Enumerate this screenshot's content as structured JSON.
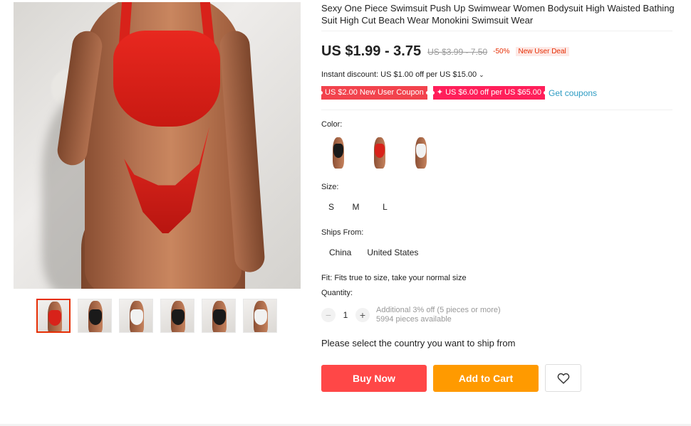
{
  "product": {
    "title": "Sexy One Piece Swimsuit Push Up Swimwear Women Bodysuit High Waisted Bathing Suit High Cut Beach Wear Monokini Swimsuit Wear",
    "price": "US $1.99 - 3.75",
    "original_price": "US $3.99 - 7.50",
    "discount": "-50%",
    "deal_badge": "New User Deal"
  },
  "discounts": {
    "instant": "Instant discount: US $1.00 off per US $15.00",
    "coupon_1": "US $2.00 New User Coupon",
    "coupon_2": "✦ US $6.00 off per US $65.00",
    "get_coupons": "Get coupons"
  },
  "options": {
    "color_label": "Color:",
    "colors": [
      {
        "name": "black",
        "suit_color": "#1a1a1a"
      },
      {
        "name": "red",
        "suit_color": "#d8221a"
      },
      {
        "name": "white",
        "suit_color": "#f1f1f1"
      }
    ],
    "size_label": "Size:",
    "sizes": [
      "S",
      "M",
      "L"
    ],
    "ships_label": "Ships From:",
    "ships_from": [
      "China",
      "United States"
    ],
    "fit": "Fit: Fits true to size, take your normal size"
  },
  "quantity": {
    "label": "Quantity:",
    "minus": "−",
    "value": "1",
    "plus": "+",
    "additional": "Additional 3% off (5 pieces or more)",
    "available": "5994 pieces available"
  },
  "ship_message": "Please select the country you want to ship from",
  "actions": {
    "buy_now": "Buy Now",
    "add_to_cart": "Add to Cart",
    "wishlist_icon": "heart-outline-icon"
  },
  "gallery": {
    "thumbnails": [
      {
        "suit_color": "#d8221a",
        "active": true
      },
      {
        "suit_color": "#1a1a1a",
        "active": false
      },
      {
        "suit_color": "#f1f1f1",
        "active": false
      },
      {
        "suit_color": "#1a1a1a",
        "active": false
      },
      {
        "suit_color": "#1a1a1a",
        "active": false
      },
      {
        "suit_color": "#f1f1f1",
        "active": false
      }
    ]
  },
  "colors": {
    "accent": "#e62e04",
    "buy": "#ff4747",
    "cart": "#ff9a00",
    "link": "#2e9cc3"
  }
}
